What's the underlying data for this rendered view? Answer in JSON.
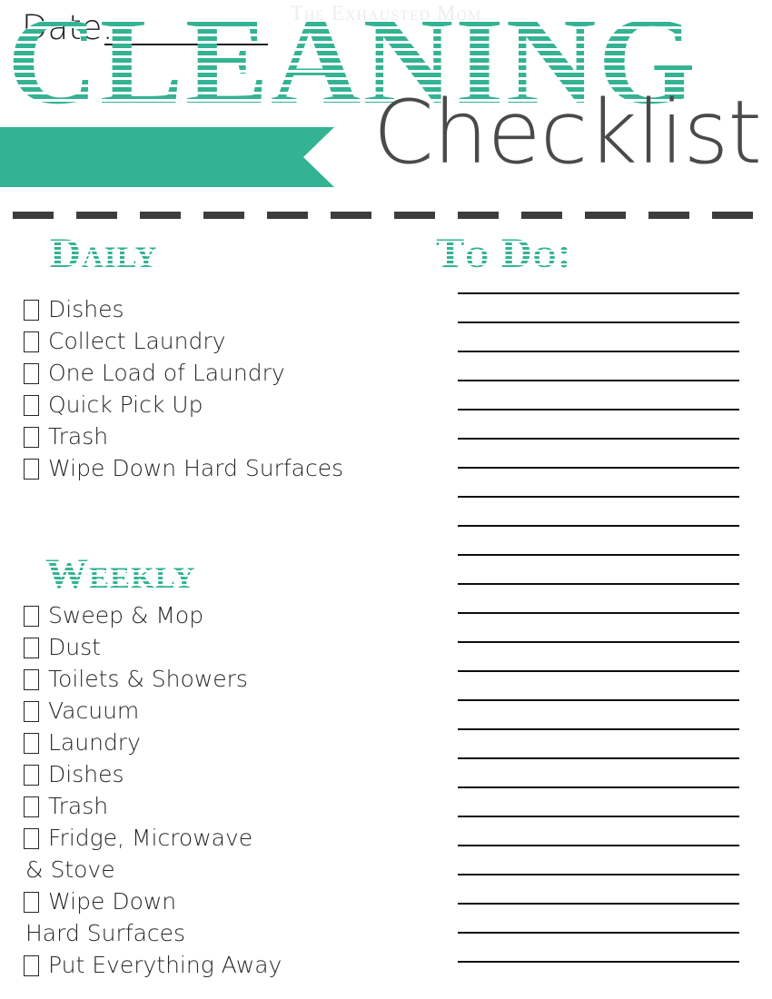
{
  "page": {
    "watermark": "The Exhausted Mom",
    "title_main": "CLEANING",
    "title_script": "Checklist",
    "accent_color": "#33b393",
    "ink_color": "#272727",
    "dark_gray": "#4a4a4a"
  },
  "date_field": {
    "label": "Date:",
    "value": "",
    "placeholder": ""
  },
  "sections": {
    "daily": {
      "heading": "Daily",
      "items": [
        {
          "label": "Dishes",
          "checked": false,
          "continuation": false
        },
        {
          "label": "Collect Laundry",
          "checked": false,
          "continuation": false
        },
        {
          "label": "One Load of Laundry",
          "checked": false,
          "continuation": false
        },
        {
          "label": "Quick Pick Up",
          "checked": false,
          "continuation": false
        },
        {
          "label": "Trash",
          "checked": false,
          "continuation": false
        },
        {
          "label": "Wipe Down Hard Surfaces",
          "checked": false,
          "continuation": false
        }
      ]
    },
    "weekly": {
      "heading": "Weekly",
      "items": [
        {
          "label": "Sweep & Mop",
          "checked": false,
          "continuation": false
        },
        {
          "label": "Dust",
          "checked": false,
          "continuation": false
        },
        {
          "label": "Toilets & Showers",
          "checked": false,
          "continuation": false
        },
        {
          "label": "Vacuum",
          "checked": false,
          "continuation": false
        },
        {
          "label": "Laundry",
          "checked": false,
          "continuation": false
        },
        {
          "label": "Dishes",
          "checked": false,
          "continuation": false
        },
        {
          "label": "Trash",
          "checked": false,
          "continuation": false
        },
        {
          "label": "Fridge, Microwave",
          "checked": false,
          "continuation": false
        },
        {
          "label": "& Stove",
          "checked": false,
          "continuation": true
        },
        {
          "label": "Wipe Down",
          "checked": false,
          "continuation": false
        },
        {
          "label": "Hard Surfaces",
          "checked": false,
          "continuation": true
        },
        {
          "label": "Put Everything Away",
          "checked": false,
          "continuation": false
        }
      ]
    },
    "todo": {
      "heading": "To Do:",
      "line_count": 24,
      "lines": [
        "",
        "",
        "",
        "",
        "",
        "",
        "",
        "",
        "",
        "",
        "",
        "",
        "",
        "",
        "",
        "",
        "",
        "",
        "",
        "",
        "",
        "",
        "",
        ""
      ]
    }
  }
}
